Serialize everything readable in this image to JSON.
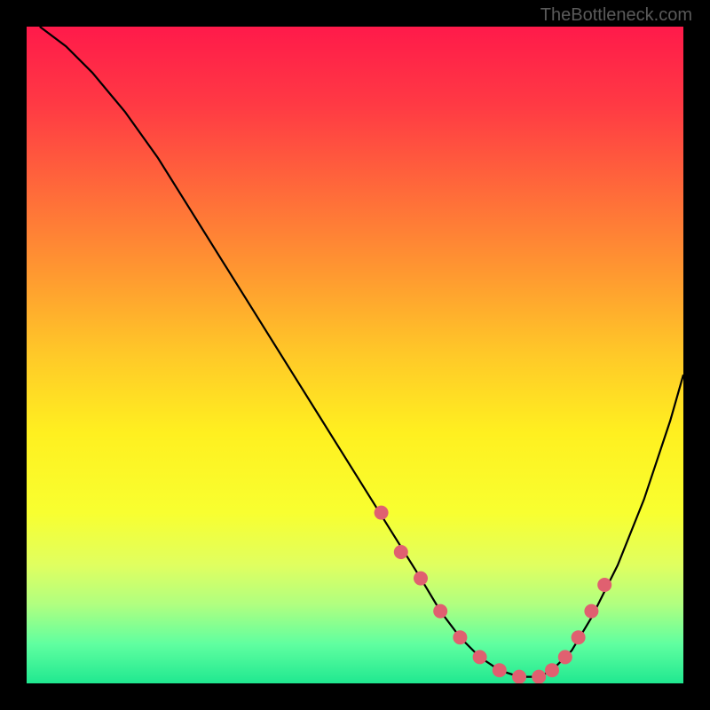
{
  "watermark": "TheBottleneck.com",
  "chart_data": {
    "type": "line",
    "title": "",
    "xlabel": "",
    "ylabel": "",
    "xlim": [
      0,
      100
    ],
    "ylim": [
      0,
      100
    ],
    "curve": {
      "x": [
        2,
        6,
        10,
        15,
        20,
        25,
        30,
        35,
        40,
        45,
        50,
        55,
        60,
        63,
        66,
        69,
        72,
        75,
        78,
        80,
        83,
        86,
        90,
        94,
        98,
        100
      ],
      "y": [
        100,
        97,
        93,
        87,
        80,
        72,
        64,
        56,
        48,
        40,
        32,
        24,
        16,
        11,
        7,
        4,
        2,
        1,
        1,
        2,
        5,
        10,
        18,
        28,
        40,
        47
      ]
    },
    "markers": {
      "x": [
        54,
        57,
        60,
        63,
        66,
        69,
        72,
        75,
        78,
        80,
        82,
        84,
        86,
        88
      ],
      "y": [
        26,
        20,
        16,
        11,
        7,
        4,
        2,
        1,
        1,
        2,
        4,
        7,
        11,
        15
      ]
    },
    "colors": {
      "curve": "#000000",
      "markers": "#e06070",
      "gradient_top": "#ff1a4a",
      "gradient_bottom": "#20e890"
    }
  }
}
